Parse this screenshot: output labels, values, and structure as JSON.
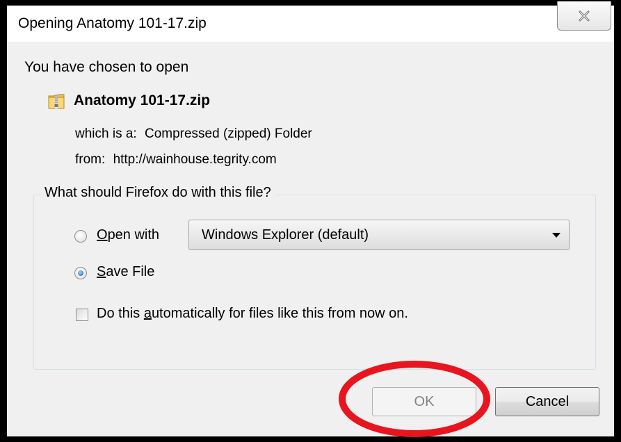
{
  "dialog": {
    "title": "Opening Anatomy 101-17.zip",
    "chosen_text": "You have chosen to open",
    "file_name": "Anatomy 101-17.zip",
    "which_is_label": "which is a:",
    "which_is_value": "Compressed (zipped) Folder",
    "from_label": "from:",
    "from_value": "http://wainhouse.tegrity.com",
    "group_label": "What should Firefox do with this file?",
    "open_with": {
      "label_prefix": "",
      "label_accel": "O",
      "label_rest": "pen with",
      "selected": false,
      "select_value": "Windows Explorer (default)"
    },
    "save_file": {
      "label_accel": "S",
      "label_rest": "ave File",
      "selected": true
    },
    "auto": {
      "label_before": "Do this ",
      "label_accel": "a",
      "label_rest": "utomatically for files like this from now on.",
      "checked": false
    },
    "ok_label": "OK",
    "cancel_label": "Cancel"
  },
  "icons": {
    "close": "close-icon",
    "file": "zip-folder-icon"
  },
  "colors": {
    "annotation_circle": "#e8141e",
    "dialog_bg": "#f0f0f0"
  }
}
